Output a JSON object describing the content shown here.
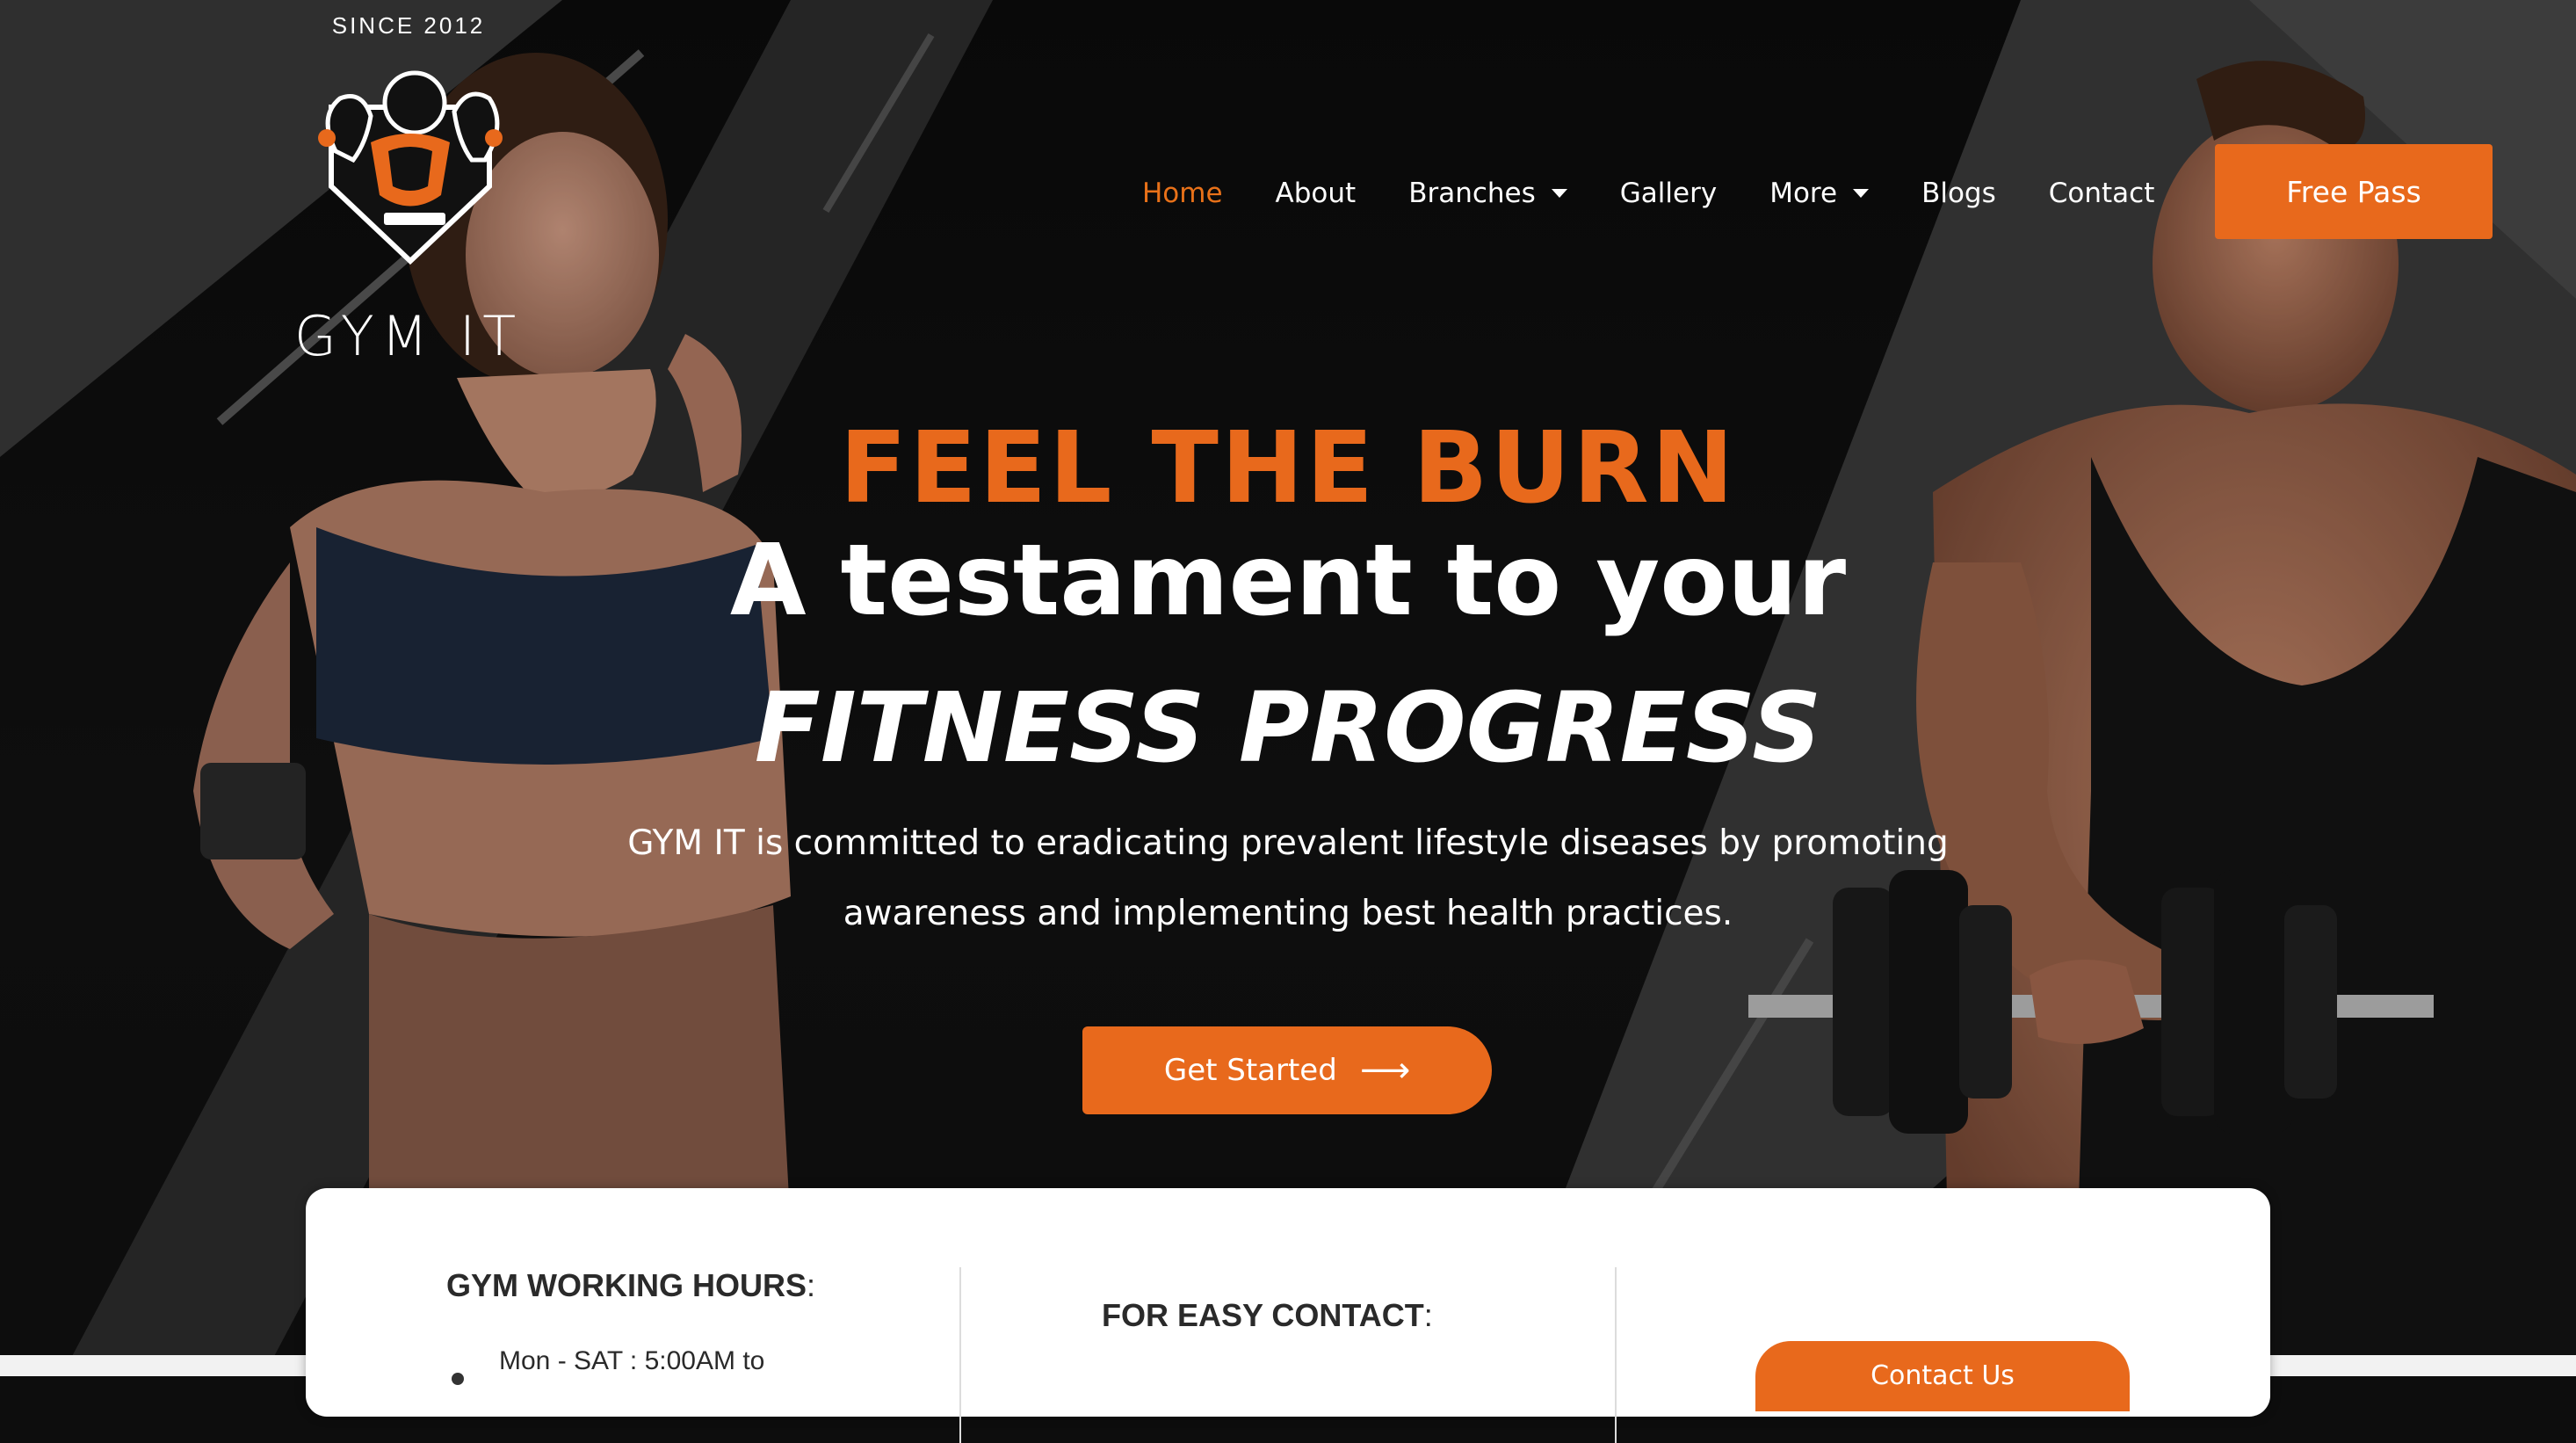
{
  "header": {
    "since": "SINCE 2012",
    "brand": "GYM  IT"
  },
  "nav": {
    "items": [
      {
        "label": "Home",
        "active": true
      },
      {
        "label": "About"
      },
      {
        "label": "Branches",
        "dropdown": true
      },
      {
        "label": "Gallery"
      },
      {
        "label": "More",
        "dropdown": true
      },
      {
        "label": "Blogs"
      },
      {
        "label": "Contact"
      }
    ],
    "cta": "Free Pass"
  },
  "hero": {
    "headline_accent": "FEEL THE BURN",
    "headline_main": "A testament to your",
    "headline_italic": "FITNESS PROGRESS",
    "description_line1": "GYM  IT is committed to eradicating prevalent lifestyle diseases by promoting",
    "description_line2": "awareness and implementing best health practices.",
    "cta": "Get Started",
    "cta_arrow": "⟶"
  },
  "info": {
    "hours_title": "GYM WORKING HOURS",
    "hours_colon": ":",
    "hours_line": "Mon - SAT : 5:00AM to",
    "contact_title": "FOR EASY CONTACT",
    "contact_colon": ":",
    "contact_button": "Contact Us"
  },
  "colors": {
    "accent": "#e8691c",
    "background": "#0d0d0d",
    "text_light": "#ffffff",
    "card_bg": "#ffffff"
  },
  "icons": {
    "logo": "gym-logo-icon",
    "dropdown": "caret-down-icon",
    "arrow": "arrow-right-icon"
  }
}
